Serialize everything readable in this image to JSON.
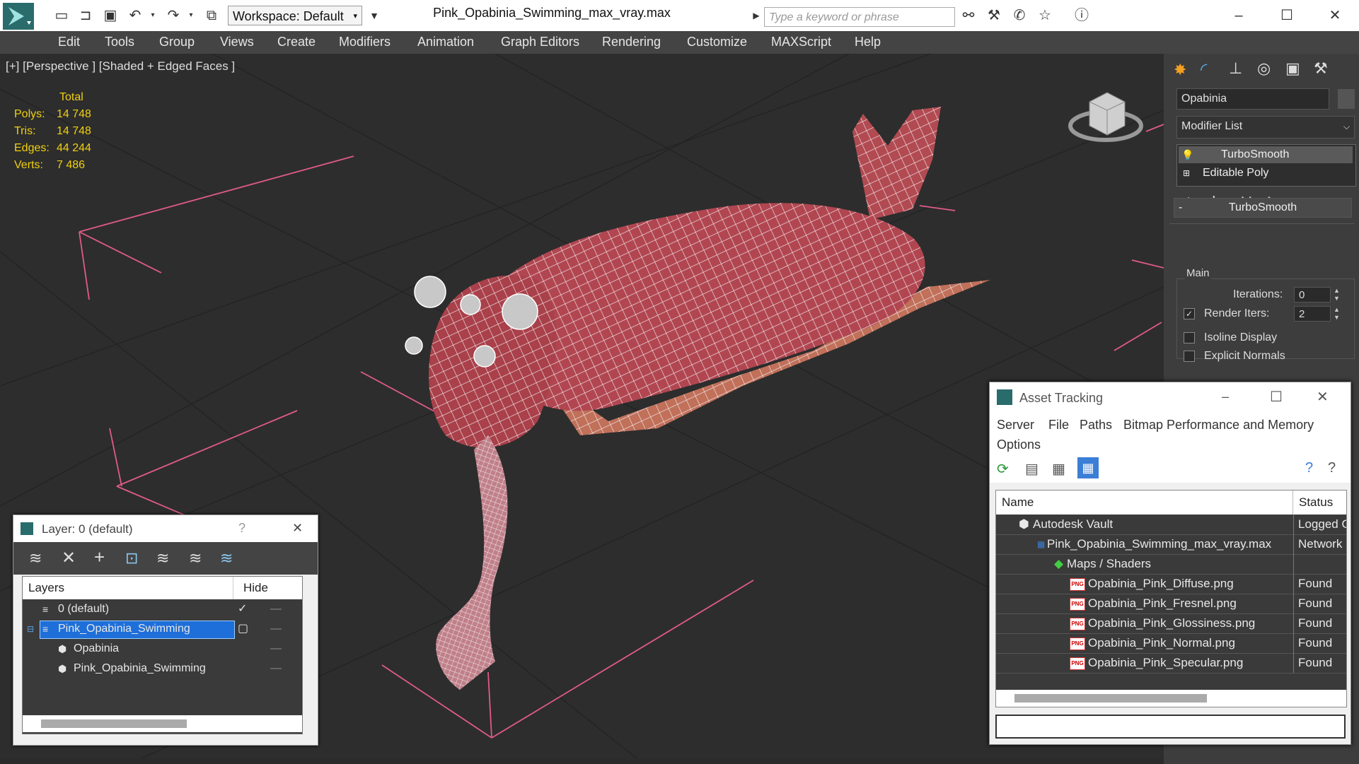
{
  "app": {
    "workspace_label": "Workspace: Default",
    "document_title": "Pink_Opabinia_Swimming_max_vray.max",
    "search_placeholder": "Type a keyword or phrase"
  },
  "menu": [
    "Edit",
    "Tools",
    "Group",
    "Views",
    "Create",
    "Modifiers",
    "Animation",
    "Graph Editors",
    "Rendering",
    "Customize",
    "MAXScript",
    "Help"
  ],
  "viewport": {
    "label": "[+] [Perspective ] [Shaded + Edged Faces ]",
    "stats_header": "Total",
    "stats": [
      {
        "key": "Polys:",
        "value": "14 748"
      },
      {
        "key": "Tris:",
        "value": "14 748"
      },
      {
        "key": "Edges:",
        "value": "44 244"
      },
      {
        "key": "Verts:",
        "value": "7 486"
      }
    ]
  },
  "command_panel": {
    "object_name": "Opabinia",
    "modifier_list": "Modifier List",
    "stack": [
      "TurboSmooth",
      "Editable Poly"
    ],
    "rollout_title": "TurboSmooth",
    "rollout_collapse": "-",
    "group_main": "Main",
    "iterations_label": "Iterations:",
    "iterations_value": "0",
    "render_iters_label": "Render Iters:",
    "render_iters_value": "2",
    "render_iters_checked": "✓",
    "isoline_label": "Isoline Display",
    "explicit_normals_label": "Explicit Normals"
  },
  "layer_window": {
    "title": "Layer: 0 (default)",
    "help": "?",
    "close": "✕",
    "col_layers": "Layers",
    "col_hide": "Hide",
    "rows": [
      {
        "label": "0 (default)",
        "check": "✓"
      },
      {
        "label": "Pink_Opabinia_Swimming"
      },
      {
        "label": "Opabinia"
      },
      {
        "label": "Pink_Opabinia_Swimming"
      }
    ]
  },
  "asset_window": {
    "title": "Asset Tracking",
    "menu": [
      "Server",
      "File",
      "Paths",
      "Bitmap Performance and Memory",
      "Options"
    ],
    "col_name": "Name",
    "col_status": "Status",
    "png_badge": "PNG",
    "rows": [
      {
        "name": "Autodesk Vault",
        "status": "Logged O"
      },
      {
        "name": "Pink_Opabinia_Swimming_max_vray.max",
        "status": "Network F"
      },
      {
        "name": "Maps / Shaders",
        "status": ""
      },
      {
        "name": "Opabinia_Pink_Diffuse.png",
        "status": "Found"
      },
      {
        "name": "Opabinia_Pink_Fresnel.png",
        "status": "Found"
      },
      {
        "name": "Opabinia_Pink_Glossiness.png",
        "status": "Found"
      },
      {
        "name": "Opabinia_Pink_Normal.png",
        "status": "Found"
      },
      {
        "name": "Opabinia_Pink_Specular.png",
        "status": "Found"
      }
    ]
  },
  "colors": {
    "stats": "#f0d010",
    "grid_pink": "#e05a8a",
    "model_pink": "#b44850",
    "selection": "#1e6fd9"
  }
}
